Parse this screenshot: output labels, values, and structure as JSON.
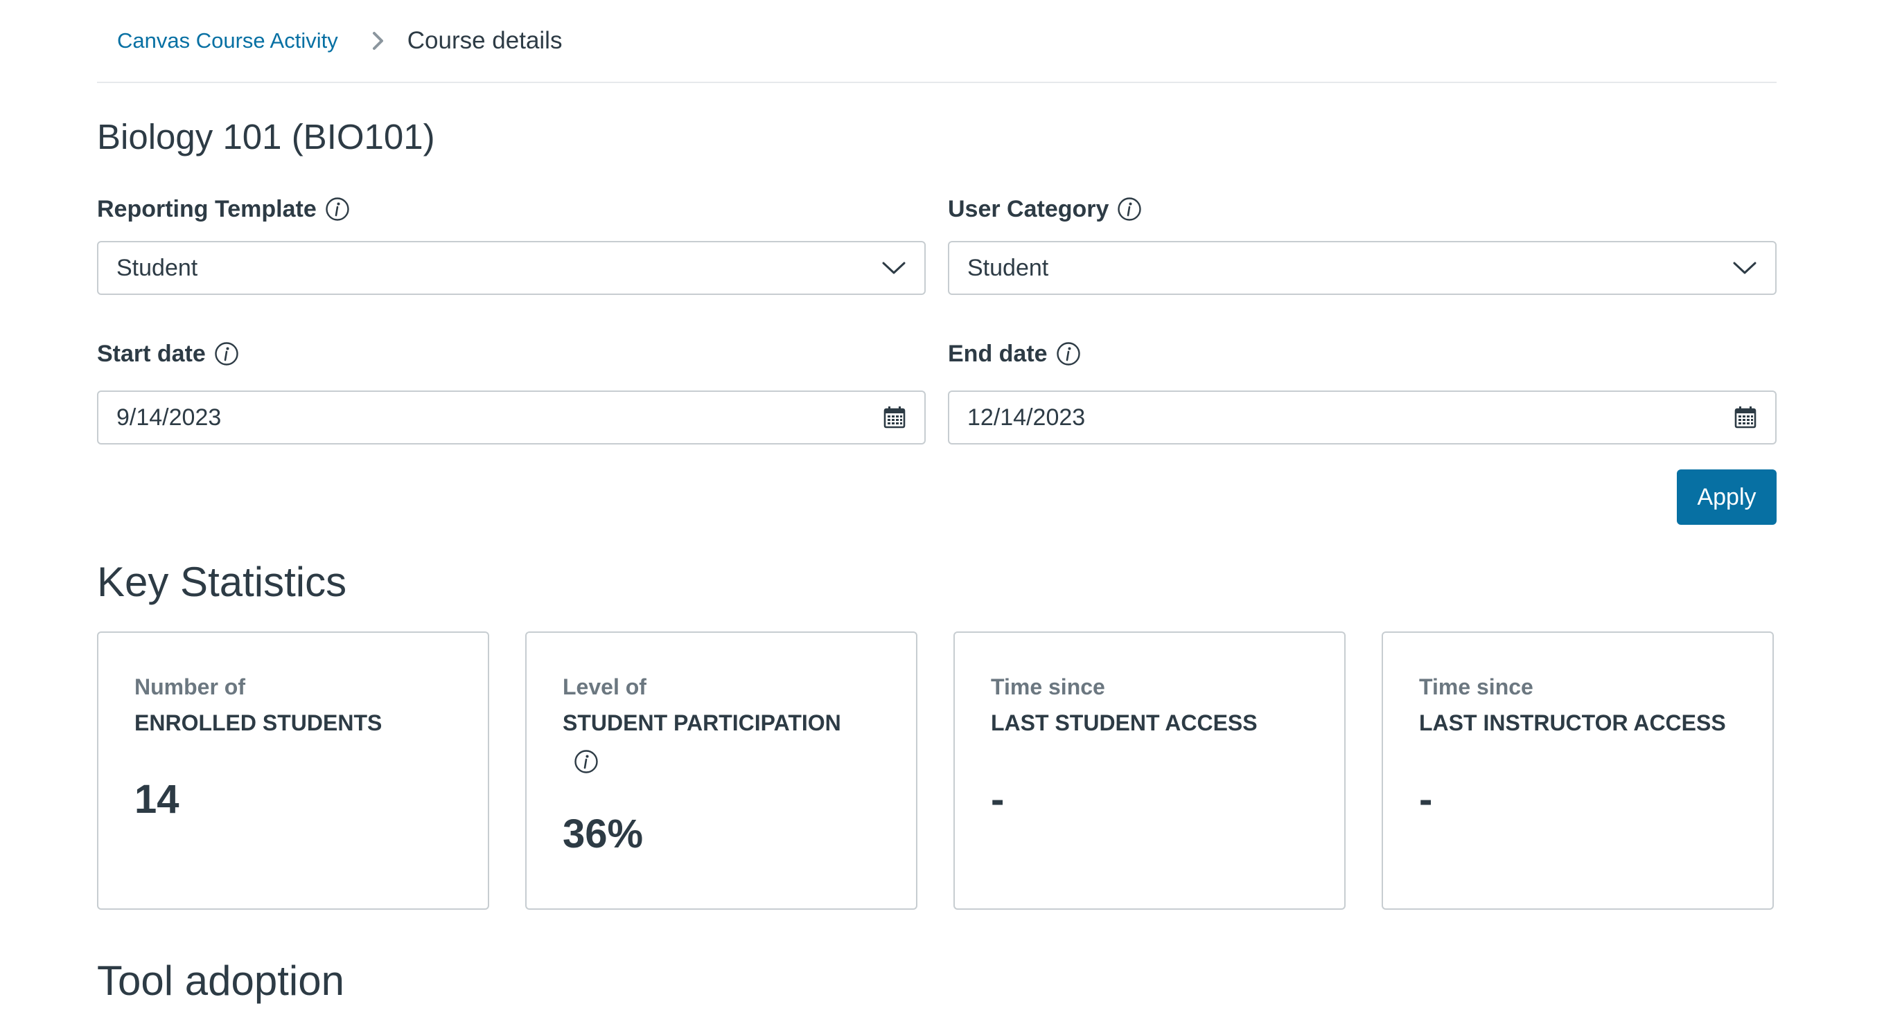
{
  "breadcrumb": {
    "parent": "Canvas Course Activity",
    "current": "Course details"
  },
  "page": {
    "title": "Biology 101 (BIO101)"
  },
  "filters": {
    "reporting_template": {
      "label": "Reporting Template",
      "value": "Student"
    },
    "user_category": {
      "label": "User Category",
      "value": "Student"
    },
    "start_date": {
      "label": "Start date",
      "value": "9/14/2023"
    },
    "end_date": {
      "label": "End date",
      "value": "12/14/2023"
    },
    "apply_label": "Apply"
  },
  "key_statistics": {
    "title": "Key Statistics",
    "cards": [
      {
        "pre": "Number of",
        "main": "ENROLLED STUDENTS",
        "value": "14"
      },
      {
        "pre": "Level of",
        "main": "STUDENT PARTICIPATION",
        "value": "36%"
      },
      {
        "pre": "Time since",
        "main": "LAST STUDENT ACCESS",
        "value": "-"
      },
      {
        "pre": "Time since",
        "main": "LAST INSTRUCTOR ACCESS",
        "value": "-"
      }
    ]
  },
  "tool_adoption": {
    "title": "Tool adoption"
  },
  "colors": {
    "accent": "#0770a3",
    "text": "#2d3b45",
    "muted": "#6b7780",
    "border": "#c7cdd1"
  },
  "icons": {
    "breadcrumb_separator": "chevron-right-icon",
    "info": "info-icon",
    "select": "chevron-down-icon",
    "date": "calendar-icon"
  }
}
